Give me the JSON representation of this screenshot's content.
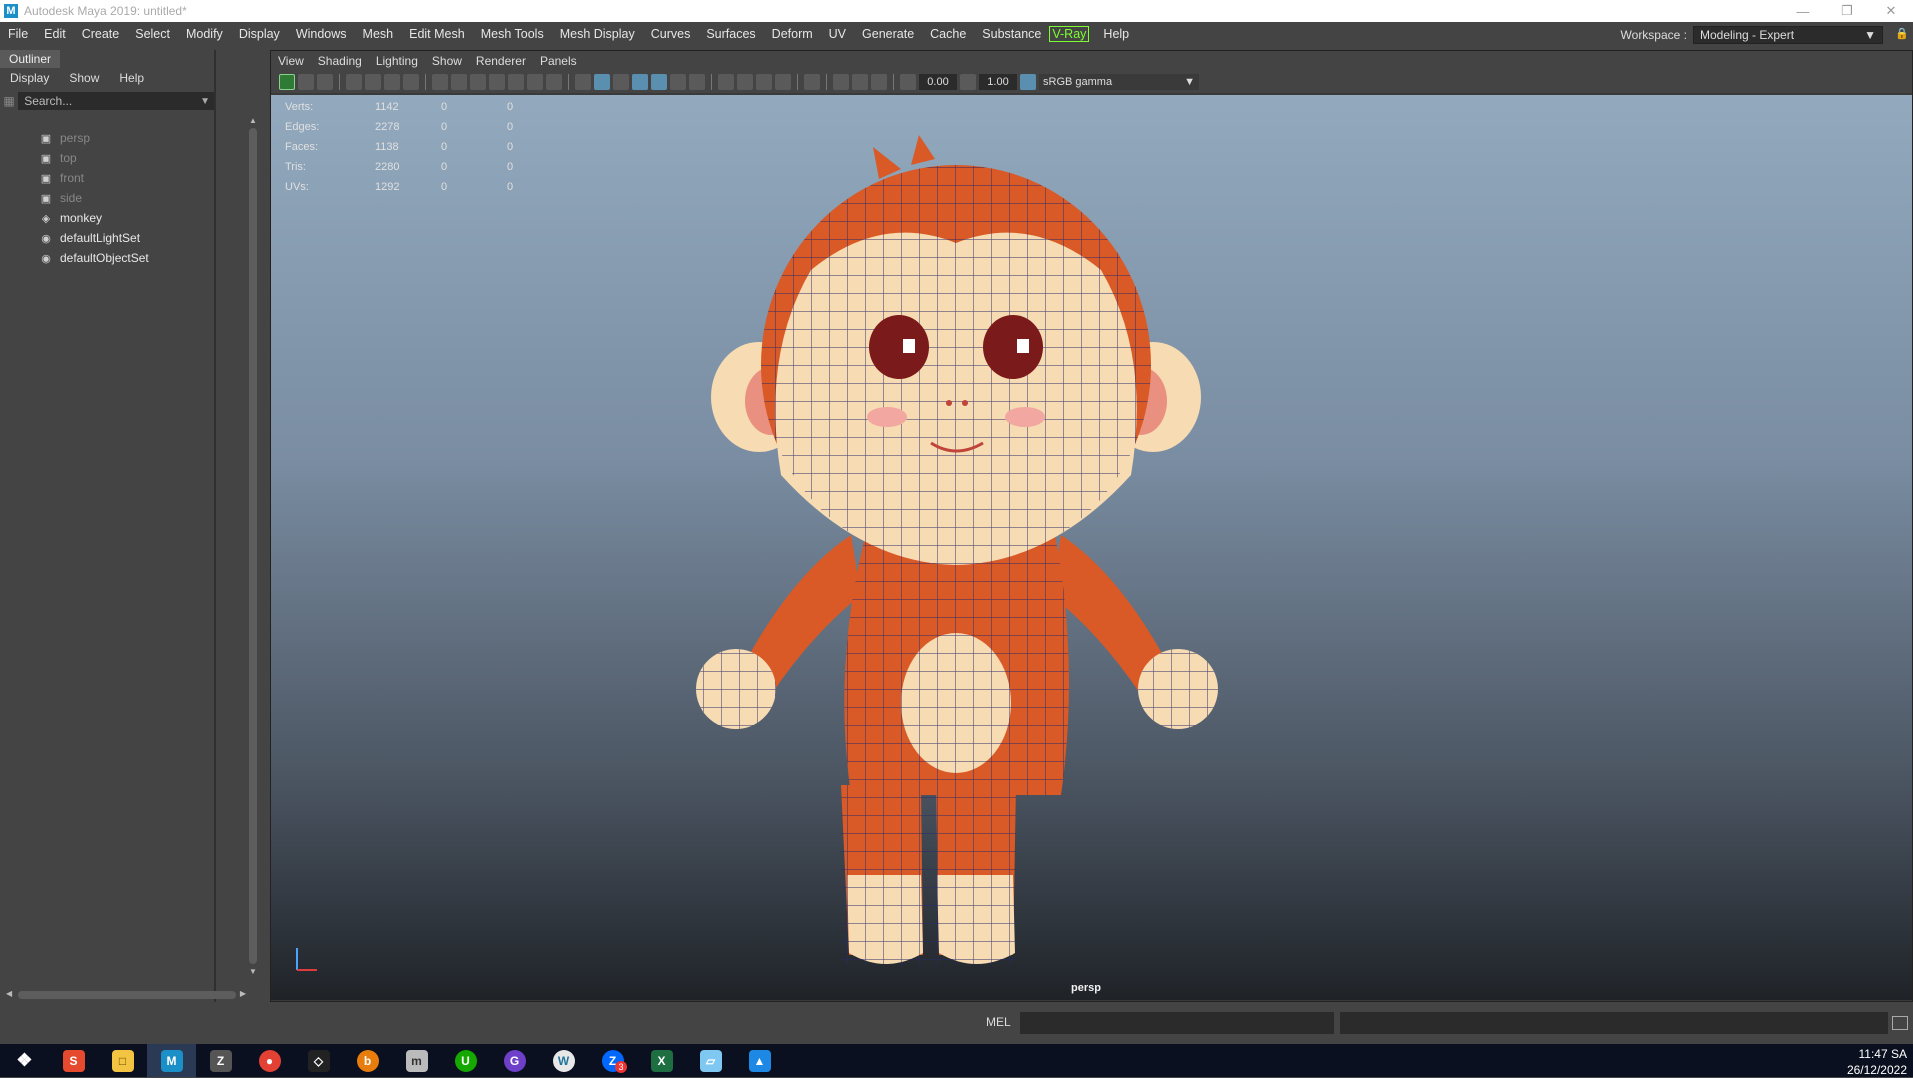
{
  "window": {
    "title": "Autodesk Maya 2019: untitled*",
    "logo_text": "M"
  },
  "menubar": [
    "File",
    "Edit",
    "Create",
    "Select",
    "Modify",
    "Display",
    "Windows",
    "Mesh",
    "Edit Mesh",
    "Mesh Tools",
    "Mesh Display",
    "Curves",
    "Surfaces",
    "Deform",
    "UV",
    "Generate",
    "Cache",
    "Substance"
  ],
  "menubar_vray": "V-Ray",
  "menubar_help": "Help",
  "workspace": {
    "label": "Workspace :",
    "value": "Modeling - Expert"
  },
  "outliner": {
    "tab": "Outliner",
    "menu": [
      "Display",
      "Show",
      "Help"
    ],
    "search_placeholder": "Search...",
    "nodes": [
      {
        "label": "persp",
        "icon": "camera-icon",
        "dim": true
      },
      {
        "label": "top",
        "icon": "camera-icon",
        "dim": true
      },
      {
        "label": "front",
        "icon": "camera-icon",
        "dim": true
      },
      {
        "label": "side",
        "icon": "camera-icon",
        "dim": true
      },
      {
        "label": "monkey",
        "icon": "mesh-icon",
        "dim": false
      },
      {
        "label": "defaultLightSet",
        "icon": "set-icon",
        "dim": false
      },
      {
        "label": "defaultObjectSet",
        "icon": "set-icon",
        "dim": false
      }
    ]
  },
  "viewport": {
    "menu": [
      "View",
      "Shading",
      "Lighting",
      "Show",
      "Renderer",
      "Panels"
    ],
    "exposure": "0.00",
    "gamma_value": "1.00",
    "color_space": "sRGB gamma",
    "camera": "persp",
    "hud": [
      {
        "label": "Verts:",
        "v1": "1142",
        "v2": "0",
        "v3": "0"
      },
      {
        "label": "Edges:",
        "v1": "2278",
        "v2": "0",
        "v3": "0"
      },
      {
        "label": "Faces:",
        "v1": "1138",
        "v2": "0",
        "v3": "0"
      },
      {
        "label": "Tris:",
        "v1": "2280",
        "v2": "0",
        "v3": "0"
      },
      {
        "label": "UVs:",
        "v1": "1292",
        "v2": "0",
        "v3": "0"
      }
    ]
  },
  "command_line": {
    "label": "MEL"
  },
  "taskbar": {
    "icons": [
      "windows-start-icon",
      "substance-icon",
      "file-explorer-icon",
      "maya-icon",
      "zbrush-icon",
      "chrome-icon",
      "unity-icon",
      "blender-icon",
      "marmoset-icon",
      "upwork-icon",
      "github-icon",
      "wordpress-icon",
      "zalo-icon",
      "excel-icon",
      "crossy-icon",
      "photos-icon"
    ],
    "badge": "3",
    "time": "11:47 SA",
    "date": "26/12/2022"
  }
}
